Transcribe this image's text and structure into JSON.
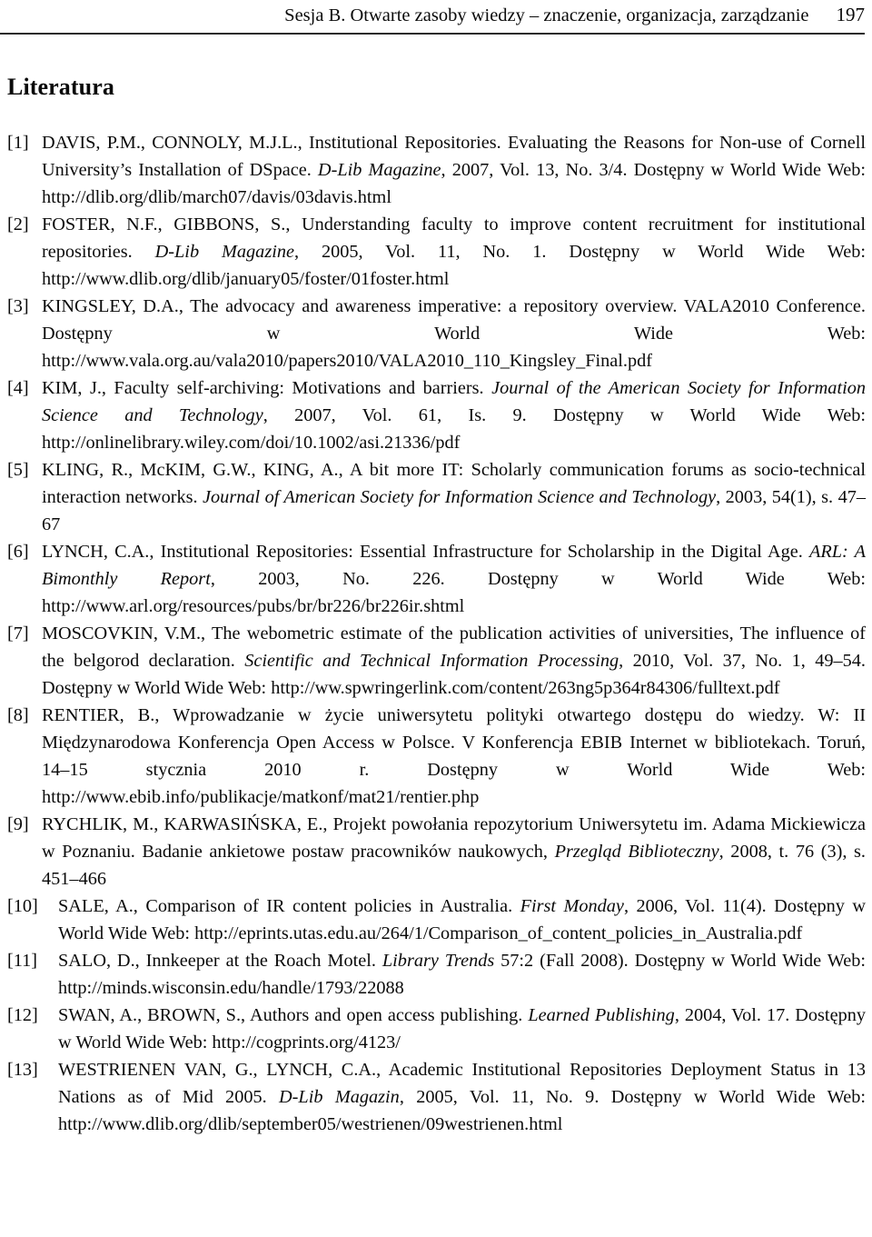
{
  "header": {
    "title": "Sesja B. Otwarte zasoby wiedzy – znaczenie, organizacja, zarządzanie",
    "page_number": "197"
  },
  "section": {
    "heading": "Literatura"
  },
  "references": [
    {
      "marker": "[1]",
      "text_html": "DAVIS, P.M., CONNOLY, M.J.L., Institutional Repositories. Evaluating the Reasons for Non-use of Cornell University’s Installation of DSpace. <i>D-Lib Magazine</i>, 2007, Vol. 13, No. 3/4. Dostępny w World Wide Web: http://dlib.org/dlib/march07/davis/03davis.html",
      "wide": false
    },
    {
      "marker": "[2]",
      "text_html": "FOSTER, N.F., GIBBONS, S., Understanding faculty to improve content recruitment for institutional repositories. <i>D-Lib Magazine</i>, 2005, Vol. 11, No. 1. Dostępny w World Wide Web: http://www.dlib.org/dlib/january05/foster/01foster.html",
      "wide": false
    },
    {
      "marker": "[3]",
      "text_html": "KINGSLEY, D.A., The advocacy and awareness imperative: a repository overview. VALA2010 Conference. Dostępny w World Wide Web: http://www.vala.org.au/vala2010/papers2010/VALA2010_110_Kingsley_Final.pdf",
      "wide": false
    },
    {
      "marker": "[4]",
      "text_html": "KIM, J., Faculty self-archiving: Motivations and barriers. <i>Journal of the American Society for Information Science and Technology</i>, 2007, Vol. 61, Is. 9. Dostępny w World Wide Web: http://onlinelibrary.wiley.com/doi/10.1002/asi.21336/pdf",
      "wide": false
    },
    {
      "marker": "[5]",
      "text_html": "KLING, R., McKIM, G.W., KING, A., A bit more IT: Scholarly communication forums as socio-technical interaction networks. <i>Journal of American Society for Information Science and Technology</i>, 2003, 54(1), s. 47–67",
      "wide": false
    },
    {
      "marker": "[6]",
      "text_html": "LYNCH, C.A., Institutional Repositories: Essential Infrastructure for Scholarship in the Digital Age. <i>ARL: A Bimonthly Report</i>, 2003, No. 226. Dostępny w World Wide Web: http://www.arl.org/resources/pubs/br/br226/br226ir.shtml",
      "wide": false
    },
    {
      "marker": "[7]",
      "text_html": "MOSCOVKIN, V.M., The webometric estimate of the publication activities of universities, The influence of the belgorod declaration. <i>Scientific and Technical Information Processing</i>, 2010, Vol. 37, No. 1, 49–54. Dostępny w World Wide Web: http://ww.spwringerlink.com/content/263ng5p364r84306/fulltext.pdf",
      "wide": false
    },
    {
      "marker": "[8]",
      "text_html": "RENTIER, B., Wprowadzanie w życie uniwersytetu polityki otwartego dostępu do wiedzy. W: II Międzynarodowa Konferencja Open Access w Polsce. V Konferencja EBIB Internet w bibliotekach. Toruń, 14–15 stycznia 2010 r. Dostępny w World Wide Web: http://www.ebib.info/publikacje/matkonf/mat21/rentier.php",
      "wide": false
    },
    {
      "marker": "[9]",
      "text_html": "RYCHLIK, M., KARWASIŃSKA, E., Projekt powołania repozytorium Uniwersytetu im. Adama Mickiewicza w Poznaniu. Badanie ankietowe postaw pracowników naukowych, <i>Przegląd Biblioteczny</i>, 2008, t. 76 (3), s. 451–466",
      "wide": false
    },
    {
      "marker": "[10]",
      "text_html": "SALE, A., Comparison of IR content policies in Australia. <i>First Monday</i>, 2006, Vol. 11(4). Dostępny w World Wide Web: http://eprints.utas.edu.au/264/1/Comparison_of_content_policies_in_Australia.pdf",
      "wide": true
    },
    {
      "marker": "[11]",
      "text_html": "SALO, D., Innkeeper at the Roach Motel. <i>Library Trends</i> 57:2 (Fall 2008). Dostępny w World Wide Web: http://minds.wisconsin.edu/handle/1793/22088",
      "wide": true
    },
    {
      "marker": "[12]",
      "text_html": "SWAN, A., BROWN, S., Authors and open access publishing. <i>Learned Publishing</i>, 2004, Vol. 17. Dostępny w World Wide Web: http://cogprints.org/4123/",
      "wide": true
    },
    {
      "marker": "[13]",
      "text_html": "WESTRIENEN VAN, G., LYNCH, C.A., Academic Institutional Repositories Deployment Status in 13 Nations as of Mid 2005. <i>D-Lib Magazin</i>, 2005, Vol. 11, No. 9. Dostępny w World Wide Web: http://www.dlib.org/dlib/september05/westrienen/09westrienen.html",
      "wide": true
    }
  ],
  "colors": {
    "text": "#0a0a0a",
    "rule": "#2b2b2b",
    "background": "#ffffff"
  }
}
